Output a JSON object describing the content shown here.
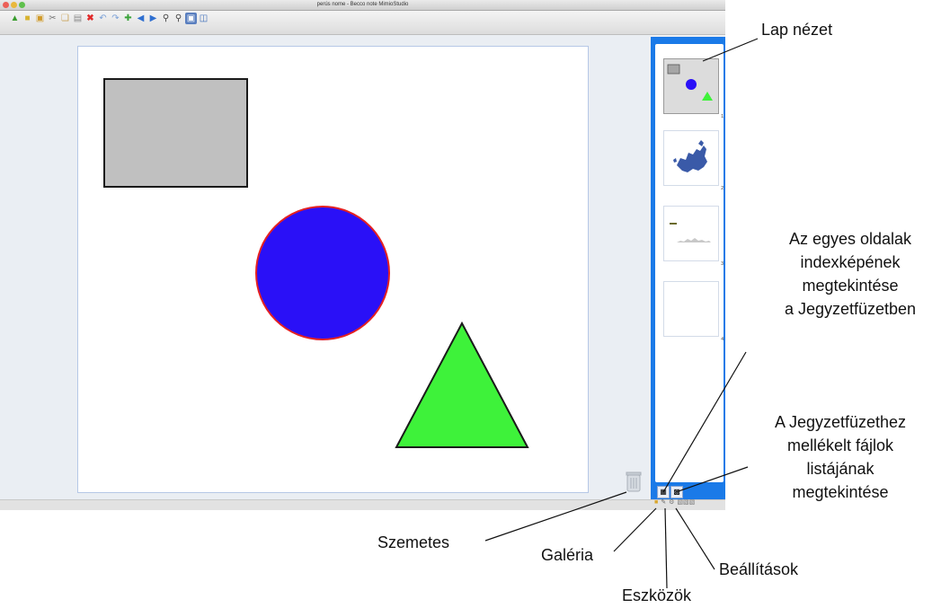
{
  "window": {
    "title": "perús nome - Becco note MimioStudio"
  },
  "toolbar": {
    "icons": [
      "open-icon",
      "save-icon",
      "print-icon",
      "cut-icon",
      "copy-icon",
      "paste-icon",
      "delete-icon",
      "undo-icon",
      "redo-icon",
      "add-page-icon",
      "prev-page-icon",
      "next-page-icon",
      "zoom-in-icon",
      "zoom-out-icon",
      "fit-icon",
      "view-icon"
    ]
  },
  "canvas": {
    "shapes": [
      {
        "kind": "rectangle",
        "fill": "#c0c0c0",
        "stroke": "#1a1a1a"
      },
      {
        "kind": "circle",
        "fill": "#2a10f7",
        "stroke": "#e52121"
      },
      {
        "kind": "triangle",
        "fill": "#3ef23a",
        "stroke": "#1a1a1a"
      }
    ]
  },
  "sidebar": {
    "thumbnails": [
      {
        "number": "1",
        "active": true
      },
      {
        "number": "2",
        "active": false
      },
      {
        "number": "3",
        "active": false
      },
      {
        "number": "4",
        "active": false
      }
    ],
    "accent": "#1a7ae8"
  },
  "callouts": {
    "page_view": "Lap nézet",
    "index_view": [
      "Az egyes oldalak",
      "indexképének",
      "megtekintése",
      "a Jegyzetfüzetben"
    ],
    "attached_files": [
      "A Jegyzetfüzethez",
      "mellékelt fájlok",
      "listájának",
      "megtekintése"
    ],
    "trash": "Szemetes",
    "gallery": "Galéria",
    "settings": "Beállítások",
    "tools": "Eszközök"
  }
}
